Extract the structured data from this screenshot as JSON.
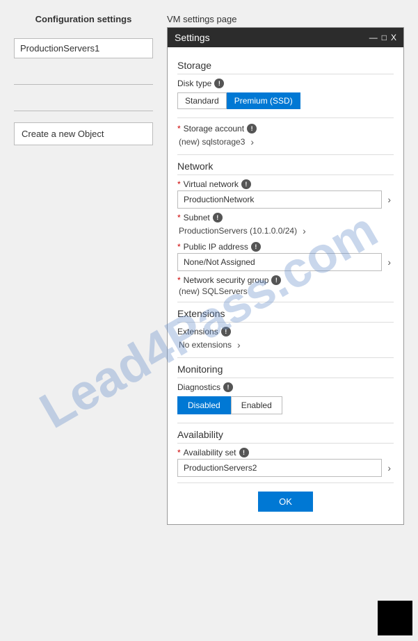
{
  "left_panel": {
    "title": "Configuration settings",
    "input1_value": "ProductionServers1",
    "create_btn_label": "Create a new Object"
  },
  "right_panel": {
    "title": "VM settings page",
    "window_title": "Settings",
    "titlebar_controls": [
      "—",
      "□",
      "X"
    ],
    "sections": {
      "storage": {
        "label": "Storage",
        "disk_type_label": "Disk type",
        "disk_standard": "Standard",
        "disk_premium": "Premium (SSD)",
        "storage_account_label": "Storage account",
        "storage_account_value": "(new) sqlstorage3"
      },
      "network": {
        "label": "Network",
        "virtual_network_label": "Virtual network",
        "virtual_network_value": "ProductionNetwork",
        "subnet_label": "Subnet",
        "subnet_value": "ProductionServers (10.1.0.0/24)",
        "public_ip_label": "Public IP address",
        "public_ip_value": "None/Not Assigned",
        "nsg_label": "Network security group",
        "nsg_value": "(new) SQLServers"
      },
      "extensions": {
        "label": "Extensions",
        "ext_label": "Extensions",
        "ext_value": "No extensions"
      },
      "monitoring": {
        "label": "Monitoring",
        "diag_label": "Diagnostics",
        "diag_disabled": "Disabled",
        "diag_enabled": "Enabled"
      },
      "availability": {
        "label": "Availability",
        "avail_set_label": "Availability set",
        "avail_set_value": "ProductionServers2"
      }
    },
    "ok_label": "OK"
  }
}
